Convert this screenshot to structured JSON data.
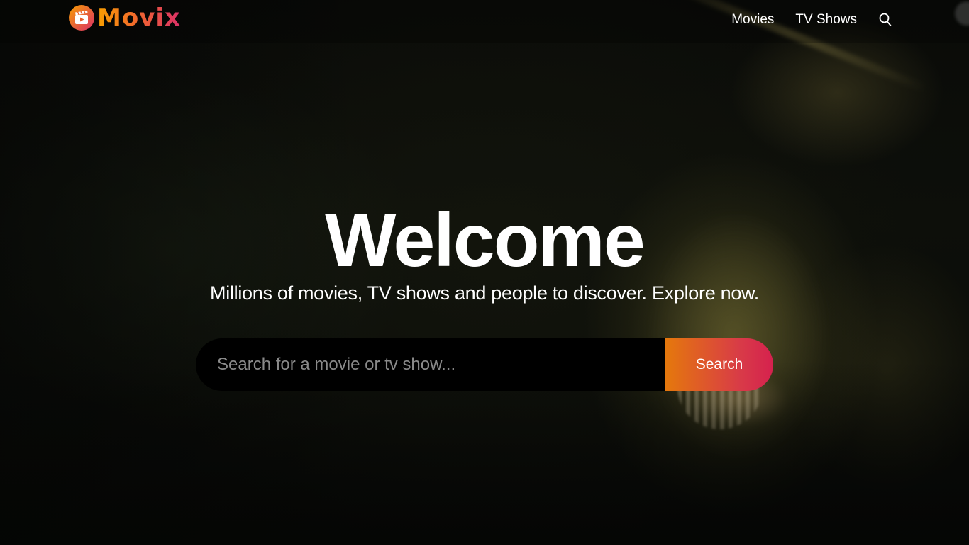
{
  "header": {
    "logo_text": "Movix",
    "nav": {
      "movies_label": "Movies",
      "tv_shows_label": "TV Shows"
    }
  },
  "hero": {
    "title": "Welcome",
    "subtitle": "Millions of movies, TV shows and people to discover. Explore now.",
    "search": {
      "placeholder": "Search for a movie or tv show...",
      "value": "",
      "button_label": "Search"
    }
  },
  "icons": {
    "logo": "movie-clapper-play-icon",
    "nav_search": "search-icon"
  },
  "colors": {
    "brand_orange": "#f89e00",
    "brand_pink": "#da2f68",
    "background": "#070806",
    "search_input_bg": "#000000",
    "text": "#ffffff"
  }
}
